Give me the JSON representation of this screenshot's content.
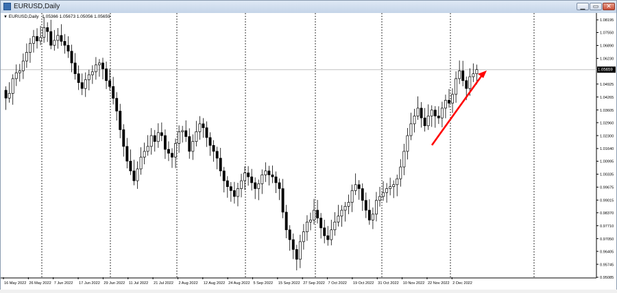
{
  "window": {
    "title": "EURUSD,Daily",
    "buttons": [
      "minimize",
      "maximize",
      "close"
    ]
  },
  "header": {
    "symbol_label": "EURUSD,Daily",
    "ohlc": "1.05366 1.05673 1.05056 1.05659"
  },
  "colors": {
    "background": "#ffffff",
    "candle": "#000000",
    "grid": "#000000",
    "arrow": "#ff0000",
    "current_price_line": "#c0c0c0"
  },
  "chart_data": {
    "type": "candlestick",
    "title": "EURUSD,Daily",
    "xlabel": "",
    "ylabel": "",
    "y_ticks": [
      "1.08195",
      "1.07550",
      "1.06890",
      "1.06230",
      "1.05659",
      "1.04925",
      "1.04265",
      "1.03605",
      "1.02960",
      "1.02300",
      "1.01640",
      "1.00995",
      "1.00335",
      "0.99675",
      "0.99015",
      "0.98370",
      "0.97710",
      "0.97050",
      "0.96405",
      "0.95745",
      "0.95085"
    ],
    "x_ticks": [
      "16 May 2022",
      "26 May 2022",
      "7 Jun 2022",
      "17 Jun 2022",
      "29 Jun 2022",
      "11 Jul 2022",
      "21 Jul 2022",
      "2 Aug 2022",
      "12 Aug 2022",
      "24 Aug 2022",
      "5 Sep 2022",
      "15 Sep 2022",
      "27 Sep 2022",
      "7 Oct 2022",
      "19 Oct 2022",
      "31 Oct 2022",
      "10 Nov 2022",
      "22 Nov 2022",
      "2 Dec 2022"
    ],
    "ylim": [
      0.95085,
      1.08195
    ],
    "current_price": "1.05659",
    "grid": "vertical dashed separators",
    "annotation": "red upward arrow",
    "closes": [
      1.0421,
      1.0445,
      1.052,
      1.055,
      1.056,
      1.061,
      1.0654,
      1.07,
      1.0735,
      1.0712,
      1.073,
      1.078,
      1.076,
      1.069,
      1.0715,
      1.074,
      1.071,
      1.069,
      1.066,
      1.06,
      1.0545,
      1.05,
      1.047,
      1.0515,
      1.054,
      1.0555,
      1.059,
      1.06,
      1.057,
      1.051,
      1.048,
      1.042,
      1.0355,
      1.026,
      1.0175,
      1.01,
      1.005,
      1.0,
      1.006,
      1.012,
      1.015,
      1.0175,
      1.023,
      1.02,
      1.0245,
      1.023,
      1.016,
      1.014,
      1.012,
      1.019,
      1.025,
      1.0255,
      1.0225,
      1.015,
      1.02,
      1.025,
      1.029,
      1.027,
      1.022,
      1.018,
      1.015,
      1.0115,
      1.005,
      1.0,
      0.997,
      0.995,
      0.992,
      0.996,
      1.0,
      1.004,
      1.002,
      0.999,
      0.996,
      0.9985,
      1.003,
      1.005,
      1.003,
      1.002,
      0.999,
      0.996,
      0.984,
      0.975,
      0.97,
      0.965,
      0.96,
      0.969,
      0.974,
      0.979,
      0.98,
      0.985,
      0.981,
      0.976,
      0.972,
      0.97,
      0.975,
      0.979,
      0.982,
      0.985,
      0.987,
      0.989,
      0.995,
      0.998,
      0.996,
      0.99,
      0.985,
      0.98,
      0.983,
      0.99,
      0.992,
      0.994,
      0.996,
      0.997,
      0.998,
      1.001,
      1.007,
      1.015,
      1.023,
      1.029,
      1.033,
      1.037,
      1.032,
      1.028,
      1.033,
      1.036,
      1.033,
      1.032,
      1.037,
      1.041,
      1.0395,
      1.044,
      1.052,
      1.056,
      1.051,
      1.047,
      1.053,
      1.0545,
      1.0566
    ]
  }
}
